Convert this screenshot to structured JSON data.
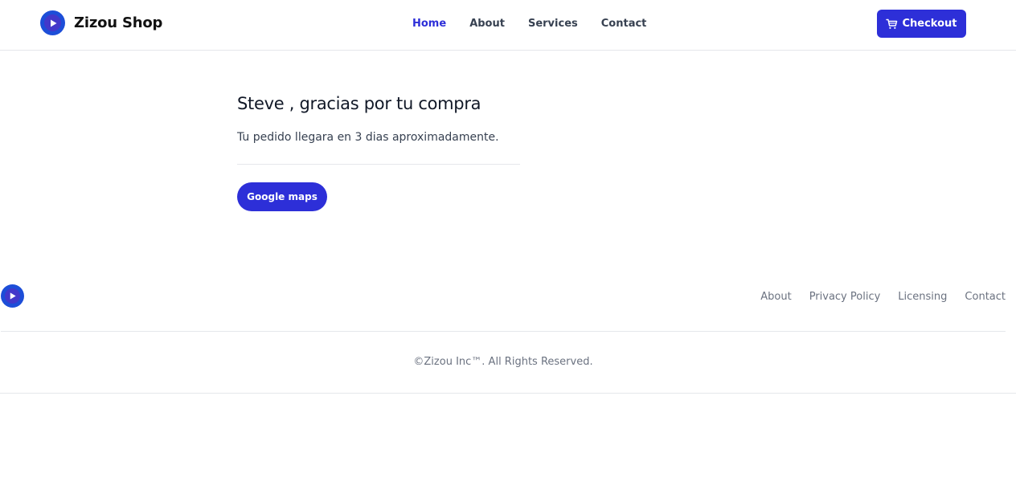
{
  "header": {
    "brand_name": "Zizou Shop",
    "nav": [
      {
        "label": "Home",
        "active": true
      },
      {
        "label": "About",
        "active": false
      },
      {
        "label": "Services",
        "active": false
      },
      {
        "label": "Contact",
        "active": false
      }
    ],
    "checkout_label": "Checkout",
    "checkout_icon": "cart-icon"
  },
  "main": {
    "title": "Steve , gracias por tu compra",
    "subtitle": "Tu pedido llegara en 3 dias aproximadamente.",
    "maps_button_label": "Google maps"
  },
  "footer": {
    "links": [
      "About",
      "Privacy Policy",
      "Licensing",
      "Contact"
    ],
    "copyright": "©Zizou Inc™. All Rights Reserved."
  },
  "colors": {
    "accent": "#2d2fd8",
    "logo_outer": "#1d4ed8",
    "logo_inner": "#4338ca",
    "muted_text": "#6b7280",
    "border": "#e5e7eb"
  }
}
